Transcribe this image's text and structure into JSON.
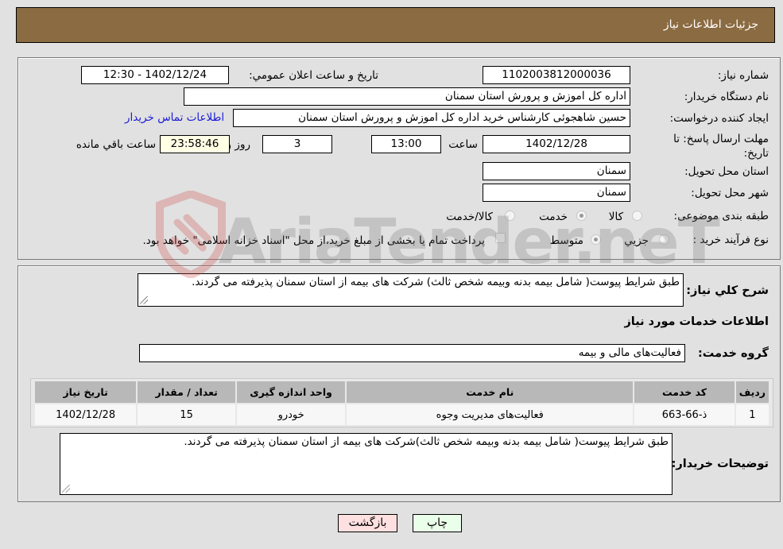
{
  "header": {
    "title": "جزئیات اطلاعات نیاز"
  },
  "info": {
    "need_number_label": "شماره نیاز:",
    "need_number": "1102003812000036",
    "announce_label": "تاريخ و ساعت اعلان عمومي:",
    "announce_value": "1402/12/24 - 12:30",
    "buyer_org_label": "نام دستگاه خريدار:",
    "buyer_org": "اداره کل اموزش و پرورش استان سمنان",
    "creator_label": "ايجاد کننده درخواست:",
    "creator": "حسین شاهجوئی کارشناس خرید اداره کل اموزش و پرورش استان سمنان",
    "contact_link": "اطلاعات تماس خريدار",
    "deadline_label": "مهلت ارسال پاسخ: تا تاريخ:",
    "deadline_date": "1402/12/28",
    "time_label": "ساعت",
    "deadline_time": "13:00",
    "days_value": "3",
    "days_label": "روز و",
    "remaining_time": "23:58:46",
    "remaining_label": "ساعت باقي مانده",
    "province_label": "استان محل تحويل:",
    "province": "سمنان",
    "city_label": "شهر محل تحويل:",
    "city": "سمنان",
    "category_label": "طبقه بندی موضوعی:",
    "category_options": [
      {
        "label": "کالا",
        "checked": false
      },
      {
        "label": "خدمت",
        "checked": true
      },
      {
        "label": "کالا/خدمت",
        "checked": false
      }
    ],
    "process_label": "نوع فرآيند خريد :",
    "process_options": [
      {
        "label": "جزيي",
        "checked": false
      },
      {
        "label": "متوسط",
        "checked": true
      }
    ],
    "payment_checkbox_checked": false,
    "payment_note": "پرداخت تمام يا بخشی از مبلغ خريد،از محل \"اسناد خزانه اسلامی\" خواهد بود."
  },
  "details": {
    "summary_label": "شرح کلي نياز:",
    "summary": "طبق شرایط پیوست( شامل بیمه بدنه وبیمه شخص ثالث) شرکت های بیمه از استان سمنان پذیرفته می گردند.",
    "services_heading": "اطلاعات خدمات مورد نياز",
    "service_group_label": "گروه خدمت:",
    "service_group": "فعالیت‌های مالی و بیمه",
    "table": {
      "headers": [
        "رديف",
        "کد خدمت",
        "نام خدمت",
        "واحد اندازه گيری",
        "تعداد / مقدار",
        "تاريخ نياز"
      ],
      "rows": [
        [
          "1",
          "ذ-66-663",
          "فعالیت‌های مدیریت وجوه",
          "خودرو",
          "15",
          "1402/12/28"
        ]
      ]
    },
    "buyer_notes_label": "توضيحات خريدار:",
    "buyer_notes": "طبق شرایط پیوست( شامل بیمه بدنه وبیمه شخص ثالث)شرکت های بیمه از استان سمنان پذیرفته می گردند."
  },
  "buttons": {
    "print": "چاپ",
    "back": "بازگشت"
  },
  "watermark": {
    "text": "AriaTender.neT"
  }
}
